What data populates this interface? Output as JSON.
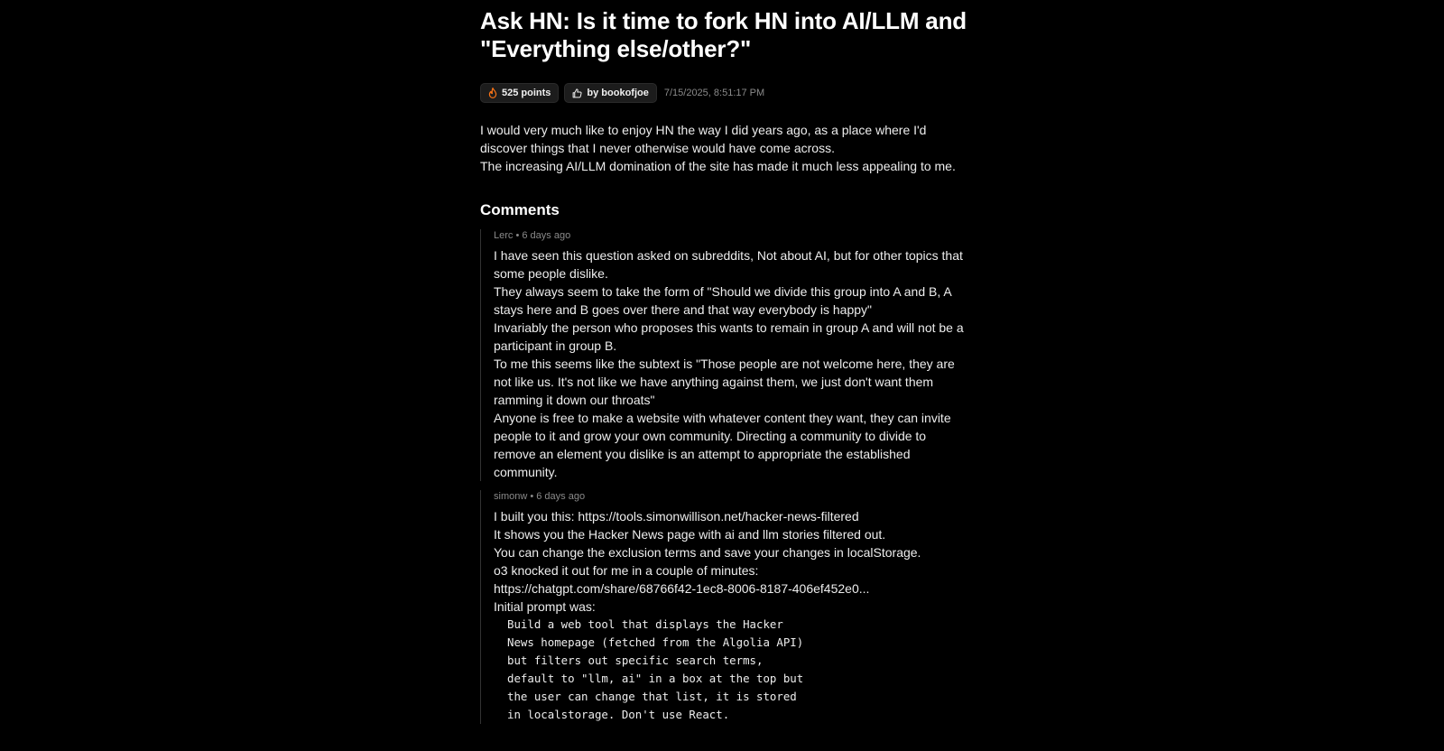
{
  "post": {
    "title": "Ask HN: Is it time to fork HN into AI/LLM and \"Everything else/other?\"",
    "points": "525 points",
    "author": "by bookofjoe",
    "date": "7/15/2025, 8:51:17 PM",
    "body": [
      "I would very much like to enjoy HN the way I did years ago, as a place where I'd discover things that I never otherwise would have come across.",
      "The increasing AI/LLM domination of the site has made it much less appealing to me."
    ]
  },
  "comments_heading": "Comments",
  "comments": [
    {
      "meta": "Lerc • 6 days ago",
      "paragraphs": [
        "I have seen this question asked on subreddits, Not about AI, but for other topics that some people dislike.",
        "They always seem to take the form of \"Should we divide this group into A and B, A stays here and B goes over there and that way everybody is happy\"",
        "Invariably the person who proposes this wants to remain in group A and will not be a participant in group B.",
        "To me this seems like the subtext is \"Those people are not welcome here, they are not like us. It's not like we have anything against them, we just don't want them ramming it down our throats\"",
        "Anyone is free to make a website with whatever content they want, they can invite people to it and grow your own community. Directing a community to divide to remove an element you dislike is an attempt to appropriate the established community."
      ]
    },
    {
      "meta": "simonw • 6 days ago",
      "paragraphs": [
        "I built you this: https://tools.simonwillison.net/hacker-news-filtered",
        "It shows you the Hacker News page with ai and llm stories filtered out.",
        "You can change the exclusion terms and save your changes in localStorage.",
        "o3 knocked it out for me in a couple of minutes:",
        "https://chatgpt.com/share/68766f42-1ec8-8006-8187-406ef452e0...",
        "Initial prompt was:"
      ],
      "code": [
        "Build a web tool that displays the Hacker",
        "News homepage (fetched from the Algolia API)",
        "but filters out specific search terms,",
        "default to \"llm, ai\" in a box at the top but",
        "the user can change that list, it is stored",
        "in localstorage. Don't use React."
      ]
    }
  ],
  "colors": {
    "background": "#000000",
    "text": "#ededed",
    "muted": "#8a8a8a",
    "badge_bg": "#1c1c1c",
    "flame": "#f97316"
  },
  "icons": {
    "points": "flame-icon",
    "author": "thumbs-up-icon"
  }
}
